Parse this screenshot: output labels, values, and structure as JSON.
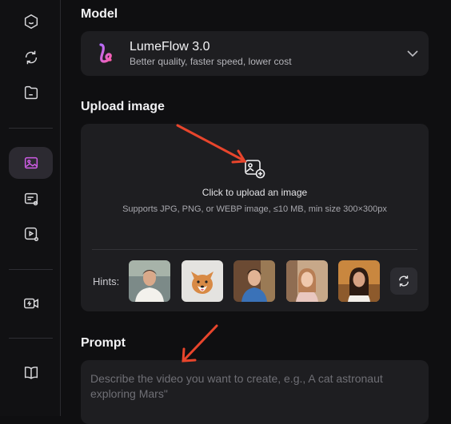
{
  "sidebar": {
    "items": [
      {
        "icon": "smile-box-icon"
      },
      {
        "icon": "refresh-loop-icon"
      },
      {
        "icon": "folder-icon"
      },
      {
        "icon": "image-add-icon",
        "active": true
      },
      {
        "icon": "card-settings-icon"
      },
      {
        "icon": "play-settings-icon"
      },
      {
        "icon": "video-flash-icon"
      },
      {
        "icon": "book-icon"
      }
    ]
  },
  "model": {
    "section_title": "Model",
    "name": "LumeFlow 3.0",
    "description": "Better quality, faster speed, lower cost"
  },
  "upload": {
    "section_title": "Upload image",
    "title": "Click to upload an image",
    "subtitle": "Supports JPG, PNG, or WEBP image, ≤10 MB, min size 300×300px",
    "hints_label": "Hints:",
    "hints": [
      {
        "name": "man-white-shirt"
      },
      {
        "name": "corgi-dog"
      },
      {
        "name": "man-blue-shirt"
      },
      {
        "name": "woman-cafe"
      },
      {
        "name": "woman-evening"
      }
    ]
  },
  "prompt": {
    "section_title": "Prompt",
    "placeholder": "Describe the video you want to create, e.g., A cat astronaut exploring Mars\""
  },
  "colors": {
    "accent": "#cf5de6",
    "annotation_arrow": "#e8452c"
  }
}
